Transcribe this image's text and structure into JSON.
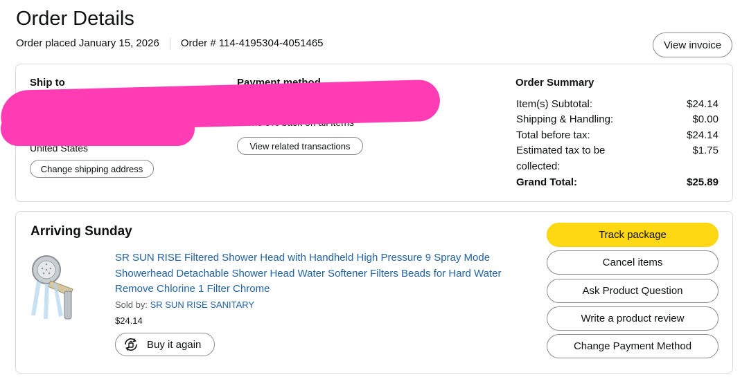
{
  "header": {
    "title": "Order Details",
    "order_placed": "Order placed January 15, 2026",
    "order_number": "Order # 114-4195304-4051465",
    "view_invoice_label": "View invoice"
  },
  "summary_box": {
    "ship_to": {
      "label": "Ship to",
      "country": "United States",
      "change_address_label": "Change shipping address"
    },
    "payment": {
      "label": "Payment method",
      "earns_text": "Earns 5% back on all items",
      "view_transactions_label": "View related transactions"
    },
    "order_summary": {
      "label": "Order Summary",
      "rows": [
        {
          "label": "Item(s) Subtotal:",
          "value": "$24.14"
        },
        {
          "label": "Shipping & Handling:",
          "value": "$0.00"
        },
        {
          "label": "Total before tax:",
          "value": "$24.14"
        },
        {
          "label": "Estimated tax to be",
          "value": "$1.75"
        },
        {
          "label": "collected:",
          "value": ""
        },
        {
          "label": "Grand Total:",
          "value": "$25.89"
        }
      ]
    }
  },
  "shipment": {
    "status": "Arriving Sunday",
    "product": {
      "title": "SR SUN RISE Filtered Shower Head with Handheld High Pressure 9 Spray Mode Showerhead Detachable Shower Head Water Softener Filters Beads for Hard Water Remove Chlorine 1 Filter Chrome",
      "sold_by_label": "Sold by: ",
      "seller": "SR SUN RISE SANITARY",
      "price": "$24.14",
      "buy_again_label": "Buy it again"
    },
    "actions": [
      "Track package",
      "Cancel items",
      "Ask Product Question",
      "Write a product review",
      "Change Payment Method"
    ]
  },
  "colors": {
    "track_button": "#ffd814",
    "link": "#2162a1",
    "redaction": "#ff3cb4"
  }
}
